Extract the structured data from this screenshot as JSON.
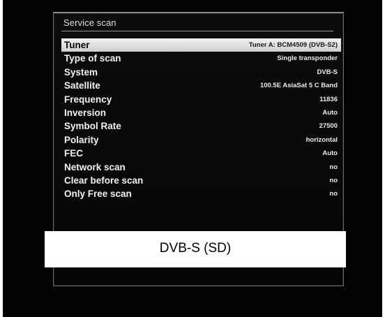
{
  "window": {
    "title": "Service scan"
  },
  "settings": [
    {
      "label": "Tuner",
      "value": "Tuner A: BCM4509 (DVB-S2)",
      "selected": true
    },
    {
      "label": "Type of scan",
      "value": "Single transponder",
      "selected": false
    },
    {
      "label": "System",
      "value": "DVB-S",
      "selected": false
    },
    {
      "label": "Satellite",
      "value": "100.5E AsiaSat 5 C Band",
      "selected": false
    },
    {
      "label": "Frequency",
      "value": "11836",
      "selected": false
    },
    {
      "label": "Inversion",
      "value": "Auto",
      "selected": false
    },
    {
      "label": "Symbol Rate",
      "value": "27500",
      "selected": false
    },
    {
      "label": "Polarity",
      "value": "horizontal",
      "selected": false
    },
    {
      "label": "FEC",
      "value": "Auto",
      "selected": false
    },
    {
      "label": "Network scan",
      "value": "no",
      "selected": false
    },
    {
      "label": "Clear before scan",
      "value": "no",
      "selected": false
    },
    {
      "label": "Only Free scan",
      "value": "no",
      "selected": false
    }
  ],
  "caption": {
    "text": "DVB-S (SD)"
  },
  "colors": {
    "background": "#020202",
    "selection": "#e6e6e6",
    "text": "#f2f2f2"
  }
}
